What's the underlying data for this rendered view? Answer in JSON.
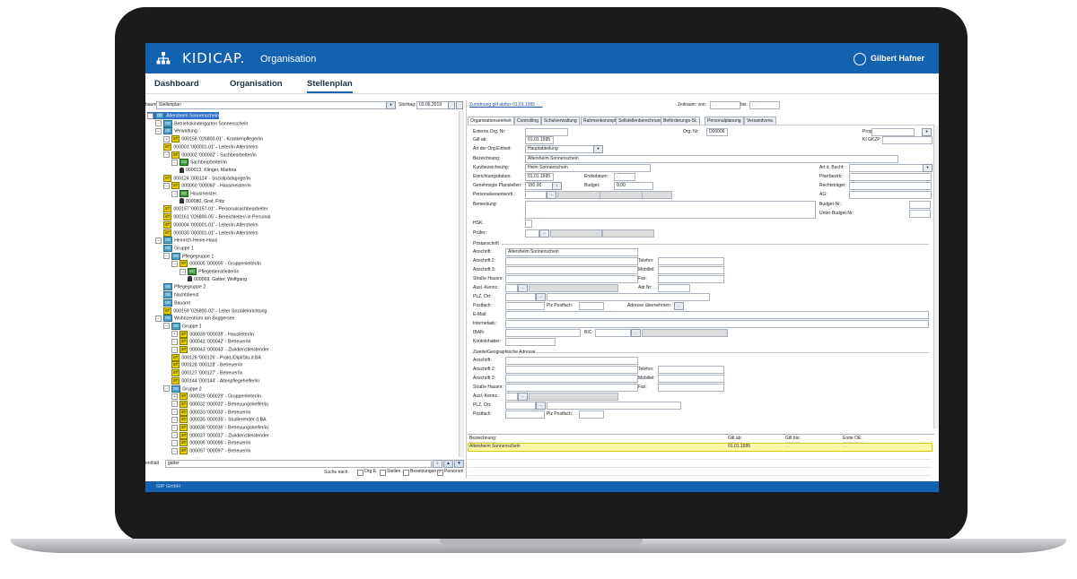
{
  "app": {
    "brand": "KIDICAP.",
    "module": "Organisation",
    "user": "Gilbert Hafner",
    "footer": "GIP GmbH",
    "accent": "#1262b0"
  },
  "nav": [
    {
      "label": "Dashboard"
    },
    {
      "label": "Organisation"
    },
    {
      "label": "Stellenplan"
    }
  ],
  "left": {
    "view_label": "baum:",
    "view_value": "Stellenplan",
    "stichtag_label": "Stichtag:",
    "stichtag_value": "03.06.2019",
    "tree": [
      {
        "icon": "OE",
        "text": "Altersheim Sonnenschein"
      },
      {
        "icon": "OE",
        "text": "Betriebskindergarten Sonnenschein"
      },
      {
        "icon": "OE",
        "text": "Verwaltung"
      },
      {
        "icon": "ST",
        "text": "000158 '026800-01' - Krankenpfleger/in"
      },
      {
        "icon": "ST",
        "text": "000001 '000001-01' - Leiter/in Altersheim"
      },
      {
        "icon": "ST",
        "text": "000002 '000002' - Sachbearbeiter/in"
      },
      {
        "icon": "SG",
        "text": "Sachbearbeiter/in"
      },
      {
        "icon": "P",
        "text": "000013, Klinger, Martina"
      },
      {
        "icon": "ST",
        "text": "000124 '000124' - Sozialpädagoge/in"
      },
      {
        "icon": "ST",
        "text": "000060 '000060' - Hausmeister/in"
      },
      {
        "icon": "SG",
        "text": "Hausmeister"
      },
      {
        "icon": "P",
        "text": "000080, Graf, Fritz"
      },
      {
        "icon": "ST",
        "text": "000157 '000157-01' - Personalsachbearbeiter"
      },
      {
        "icon": "ST",
        "text": "000161 '026800-05' - Bereichleiter/-in Personal"
      },
      {
        "icon": "ST",
        "text": "000004 '000001-01' - Leiter/in Altersheim"
      },
      {
        "icon": "ST",
        "text": "000030 '000001-01' - Leiter/in Altersheim"
      },
      {
        "icon": "OE",
        "text": "Heinrich-Heine-Haus"
      },
      {
        "icon": "OE",
        "text": "Gruppe 1"
      },
      {
        "icon": "OE",
        "text": "Pflegegruppe 1"
      },
      {
        "icon": "ST",
        "text": "000005 '000005' - Gruppenleiter/in"
      },
      {
        "icon": "SG",
        "text": "Pflegedienstleiter/in"
      },
      {
        "icon": "P",
        "text": "000069, Gatter, Wolfgang"
      },
      {
        "icon": "OE",
        "text": "Pflegegruppe 2"
      },
      {
        "icon": "OE",
        "text": "Nachtdienst"
      },
      {
        "icon": "OE",
        "text": "Bauamt"
      },
      {
        "icon": "ST",
        "text": "000159 '026800-02' - Leiter Sozialeinrichtung"
      },
      {
        "icon": "OE",
        "text": "Wohnzentrum  am Baggersee"
      },
      {
        "icon": "OE",
        "text": "Gruppe 1"
      },
      {
        "icon": "ST",
        "text": "000039 '000039' - Hausleiter/in"
      },
      {
        "icon": "ST",
        "text": "000042 '000042' - Betreuer/in"
      },
      {
        "icon": "ST",
        "text": "000043 '000043' - Zivildienstleistender"
      },
      {
        "icon": "ST",
        "text": "000126 '000126' - Prakt./Dipl/Stu.d.BA"
      },
      {
        "icon": "ST",
        "text": "000128 '000128' - Betreuer/in"
      },
      {
        "icon": "ST",
        "text": "000127 '000127' - Betreuer/in"
      },
      {
        "icon": "ST",
        "text": "000144 '000144' - Altenpflegehelfer/in"
      },
      {
        "icon": "OE",
        "text": "Gruppe 2"
      },
      {
        "icon": "ST",
        "text": "000029 '000029' - Gruppenleiter/in"
      },
      {
        "icon": "ST",
        "text": "000032 '000032' - Betreuungshelfer/in"
      },
      {
        "icon": "ST",
        "text": "000033 '000033' - Betreuer/in"
      },
      {
        "icon": "ST",
        "text": "000035 '000035' - Studierender d.BA"
      },
      {
        "icon": "ST",
        "text": "000036 '000036' - Betreuungshelfer/in"
      },
      {
        "icon": "ST",
        "text": "000037 '000037' - Zivildienstleistender"
      },
      {
        "icon": "ST",
        "text": "000096 '000096' - Betreuer/in"
      },
      {
        "icon": "ST",
        "text": "000097 '000097' - Betreuer/in"
      }
    ],
    "search_label": "enthält",
    "search_value": "gatter",
    "search_by_label": "Suche nach:",
    "checks": [
      {
        "label": "Org.E.",
        "checked": false
      },
      {
        "label": "Stellen",
        "checked": false
      },
      {
        "label": "Besetzungen",
        "checked": false
      },
      {
        "label": "Personen",
        "checked": true
      }
    ]
  },
  "right": {
    "zuordnung": "Zuordnung gilt ab/bis 01.01.1995 - . .",
    "zeitraum_von_label": "Zeitraum: von:",
    "zeitraum_von": ". .",
    "zeitraum_bis_label": "bis:",
    "zeitraum_bis": ". .",
    "tabs": [
      "Organisationseinheit",
      "Controlling",
      "Schulverwaltung",
      "Rahmenkonzept",
      "Sollstellenberechnung",
      "Beförderungs-St.",
      "Personalplanung",
      "Versandverw."
    ],
    "fields": {
      "ext_org_nr": "Externe Org. Nr:",
      "org_nr_label": "Org. Nr:",
      "org_nr": "D00006",
      "gilt_ab_label": "Gilt ab:",
      "gilt_ab": "01.01.1995",
      "art_label": "Art der Org.Einheit:",
      "art": "Hauptabteilung",
      "bez_label": "Bezeichnung:",
      "bez": "Altersheim Sonnenschein",
      "kurz_label": "Kurzbezeichnung:",
      "kurz": "Heim Sonnenschein",
      "einricht_label": "Einrichtungsdatum:",
      "einricht": "01.01.1995",
      "ende_label": "Endedatum:",
      "ende": ". .",
      "planstellen_label": "Genehmigte Planstellen:",
      "planstellen": "150,00",
      "budget_label": "Budget:",
      "budget": "0,00",
      "persverant_label": "Personalverantwortl.:",
      "bemerkung_label": "Bemerkung:",
      "hsk_label": "HSK:",
      "pruefer_label": "Prüfer:",
      "prop_label": "Propstei:",
      "kigkzp_label": "KI GKZP",
      "art_buchf_label": "Art d. Buchf:",
      "pfarrbezirk_label": "Pfarrbezirk:",
      "rechtstraeger_label": "Rechtsträger:",
      "ag_label": "AG:",
      "budgetnr_label": "Budget-Nr.:",
      "unterbudget_label": "Unter-Budget-Nr:"
    },
    "postanschrift": {
      "title": "Postanschrift",
      "anschrift_label": "Anschrift:",
      "anschrift": "Altersheim Sonnenschein",
      "anschrift2_label": "Anschrift 2:",
      "anschrift3_label": "Anschrift 3:",
      "strasse_label": "Straße Hausnr:",
      "ausl_label": "Ausl.-Kennz.:",
      "plz_label": "PLZ, Ort:",
      "postfach_label": "Postfach:",
      "plz_postfach_label": "Plz Postfach:",
      "email_label": "E-Mail:",
      "internet_label": "Internetadr.:",
      "iban_label": "IBAN:",
      "bic_label": "BIC:",
      "kontoinhaber_label": "Kontoinhaber:",
      "telefon_label": "Telefon:",
      "mobil_label": "Mobiltel:",
      "fax_label": "Fax:",
      "adrnr_label": "Adr.Nr:",
      "adr_uebernehmen_label": "Adresse übernehmen:"
    },
    "zweite": {
      "title": "Zweite/Geographische Adresse",
      "anschrift_label": "Anschrift:",
      "anschrift2_label": "Anschrift 2:",
      "anschrift3_label": "Anschrift 3:",
      "strasse_label": "Straße Hausnr:",
      "ausl_label": "Ausl.-Kennz.:",
      "plz_label": "PLZ, Ort:",
      "postfach_label": "Postfach:",
      "plz_postfach_label": "Plz Postfach:",
      "telefon_label": "Telefon:",
      "mobil_label": "Mobiltel:",
      "fax_label": "Fax:"
    },
    "grid": {
      "headers": [
        "Bezeichnung:",
        "Gilt ab:",
        "Gilt bis:",
        "Ende OE:"
      ],
      "rows": [
        [
          "Altersheim Sonnenschein",
          "01.01.1995",
          ". .",
          ". ."
        ]
      ]
    }
  }
}
